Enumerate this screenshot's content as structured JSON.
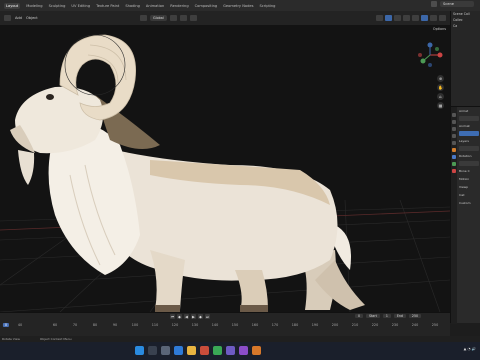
{
  "topbar": {
    "workspaces": [
      "Layout",
      "Modeling",
      "Sculpting",
      "UV Editing",
      "Texture Paint",
      "Shading",
      "Animation",
      "Rendering",
      "Compositing",
      "Geometry Nodes",
      "Scripting"
    ],
    "active_index": 0,
    "scene": "Scene"
  },
  "viewport_header": {
    "mode_menus": [
      "Add",
      "Object"
    ],
    "transform": "Global",
    "options": "Options"
  },
  "outliner": {
    "rows": [
      "Scene Coll",
      "Collec",
      "Ca"
    ]
  },
  "properties": {
    "rows": [
      "Armat",
      "Animat",
      "Layers",
      "Rotation",
      "Bone C",
      "Motion",
      "Viewp",
      "Inst",
      "Custom"
    ]
  },
  "timeline": {
    "current_frame": "0",
    "start_label": "Start",
    "start_value": "1",
    "end_label": "End",
    "end_value": "250",
    "ticks": [
      "0",
      "40",
      "60",
      "70",
      "80",
      "90",
      "100",
      "110",
      "120",
      "130",
      "140",
      "150",
      "160",
      "170",
      "180",
      "190",
      "200",
      "210",
      "220",
      "230",
      "240",
      "250"
    ]
  },
  "status": {
    "left": "Rotate View",
    "center": "Object Context Menu"
  },
  "colors": {
    "ram_body": "#ebe3d7",
    "ram_shadow": "#c9b59d",
    "horn": "#e9dcc7",
    "mane_brown": "#7b6a52",
    "accent_blue": "#4a72b8"
  }
}
